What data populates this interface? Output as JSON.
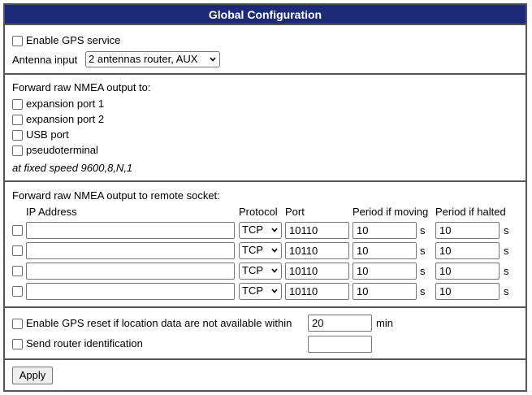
{
  "title": "Global Configuration",
  "gps": {
    "enable_label": "Enable GPS service",
    "antenna_label": "Antenna input",
    "antenna_value": "2 antennas router, AUX"
  },
  "forward": {
    "heading": "Forward raw NMEA output to:",
    "options": [
      "expansion port 1",
      "expansion port 2",
      "USB port",
      "pseudoterminal"
    ],
    "note": "at fixed speed 9600,8,N,1"
  },
  "socket": {
    "heading": "Forward raw NMEA output to remote socket:",
    "headers": {
      "ip": "IP Address",
      "protocol": "Protocol",
      "port": "Port",
      "moving": "Period if moving",
      "halted": "Period if halted"
    },
    "unit": "s",
    "rows": [
      {
        "ip": "",
        "protocol": "TCP",
        "port": "10110",
        "moving": "10",
        "halted": "10"
      },
      {
        "ip": "",
        "protocol": "TCP",
        "port": "10110",
        "moving": "10",
        "halted": "10"
      },
      {
        "ip": "",
        "protocol": "TCP",
        "port": "10110",
        "moving": "10",
        "halted": "10"
      },
      {
        "ip": "",
        "protocol": "TCP",
        "port": "10110",
        "moving": "10",
        "halted": "10"
      }
    ]
  },
  "reset": {
    "label": "Enable GPS reset if location data are not available within",
    "value": "20",
    "unit": "min",
    "send_id_label": "Send router identification",
    "send_id_value": ""
  },
  "apply_label": "Apply"
}
